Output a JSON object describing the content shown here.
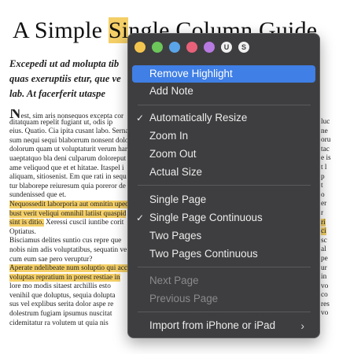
{
  "document": {
    "title_before": "A Simple ",
    "title_highlight": "Si",
    "title_rest": "ngle Column Guide",
    "subtitle_lines": [
      "Excepedi ut ad molupta tib",
      "quas exeruptiis etur, que ve",
      "lab. At facerferit utaspe"
    ],
    "body_lines": [
      {
        "text": "est, sim aris nonsequos excepta cor",
        "hl": false
      },
      {
        "text": "ditatquam repelit fugiant ut, odis ip",
        "hl": false
      },
      {
        "text": "eius. Quatio. Cia ipita cusant labo. Serna",
        "hl": false
      },
      {
        "text": "sum nequi sequi blaborrum nonsent dolo",
        "hl": false
      },
      {
        "text": "dolorum quam ut voluptaturit verum haru",
        "hl": false
      },
      {
        "text": "uaeptatquo bla deni culparum doloreput",
        "hl": false
      },
      {
        "text": "ame veliquod que et et hitatae. Itaspel i",
        "hl": false
      },
      {
        "text": "aliquam, sitiosenist. Em que rati in sequ",
        "hl": false
      },
      {
        "text": "tur blaborepe reiuresum quia poreror de a",
        "hl": false
      },
      {
        "text": "sundenissed que et.",
        "hl": false
      },
      {
        "text": "Nequossedit laborporia aut omnitin uped",
        "hl": true
      },
      {
        "text": "bust verit veliqui omnihil latiist quaspid",
        "hl": true
      },
      {
        "text": "sint is ditio.",
        "hl": true,
        "after": " Xeressi cuscil iuntibe corit"
      },
      {
        "text": "Optiatus.",
        "hl": false
      },
      {
        "text": "Bisciamus delites suntio cus repre que",
        "hl": false
      },
      {
        "text": "nobis nim adis voluptatibus, sequatin ve",
        "hl": false
      },
      {
        "text": "cum eum sae pero veruptur?",
        "hl": false
      },
      {
        "text": "Aperate ndelibeate num soluptio qui accu",
        "hl": true
      },
      {
        "text": "voluptas repratium in porest restiae in",
        "hl": true
      },
      {
        "text": "lore mo modis sitaest archillis esto",
        "hl": false
      },
      {
        "text": "venihil que doluptus, sequia dolupta",
        "hl": false
      },
      {
        "text": "sus vel explibus serita dolor aspe re",
        "hl": false
      },
      {
        "text": "dolestrum fugiam ipsumus nuscitat",
        "hl": false
      },
      {
        "text": "cidemitatur ra volutem ut quia nis",
        "hl": false
      }
    ],
    "right_lines": [
      {
        "text": "luc",
        "hl": false
      },
      {
        "text": "ne",
        "hl": false
      },
      {
        "text": "oru",
        "hl": false
      },
      {
        "text": "tac",
        "hl": false
      },
      {
        "text": "e is",
        "hl": false
      },
      {
        "text": "t l",
        "hl": false
      },
      {
        "text": "p",
        "hl": false
      },
      {
        "text": "t",
        "hl": false
      },
      {
        "text": "o",
        "hl": false
      },
      {
        "text": "er",
        "hl": false
      },
      {
        "text": "r",
        "hl": false
      },
      {
        "text": "ri",
        "hl": true
      },
      {
        "text": "ci",
        "hl": true
      },
      {
        "text": "sc",
        "hl": false
      },
      {
        "text": "al",
        "hl": false
      },
      {
        "text": "pe",
        "hl": false
      },
      {
        "text": "ur",
        "hl": false
      },
      {
        "text": "in",
        "hl": false
      },
      {
        "text": "vo",
        "hl": false
      },
      {
        "text": "co",
        "hl": false
      },
      {
        "text": "res",
        "hl": false
      },
      {
        "text": "vo",
        "hl": false
      }
    ]
  },
  "menu": {
    "highlight_colors": [
      {
        "name": "yellow",
        "color": "#f4c54e"
      },
      {
        "name": "green",
        "color": "#6cc65a"
      },
      {
        "name": "blue",
        "color": "#5aa5e8"
      },
      {
        "name": "pink",
        "color": "#e86179"
      },
      {
        "name": "purple",
        "color": "#b77ae0"
      }
    ],
    "underline_label": "U",
    "strikethrough_label": "S",
    "items": {
      "remove_highlight": "Remove Highlight",
      "add_note": "Add Note",
      "auto_resize": "Automatically Resize",
      "zoom_in": "Zoom In",
      "zoom_out": "Zoom Out",
      "actual_size": "Actual Size",
      "single_page": "Single Page",
      "single_page_continuous": "Single Page Continuous",
      "two_pages": "Two Pages",
      "two_pages_continuous": "Two Pages Continuous",
      "next_page": "Next Page",
      "previous_page": "Previous Page",
      "import_iphone": "Import from iPhone or iPad"
    },
    "checkmark": "✓",
    "submenu_chevron": "›",
    "accent_color": "#3f7fe6"
  }
}
